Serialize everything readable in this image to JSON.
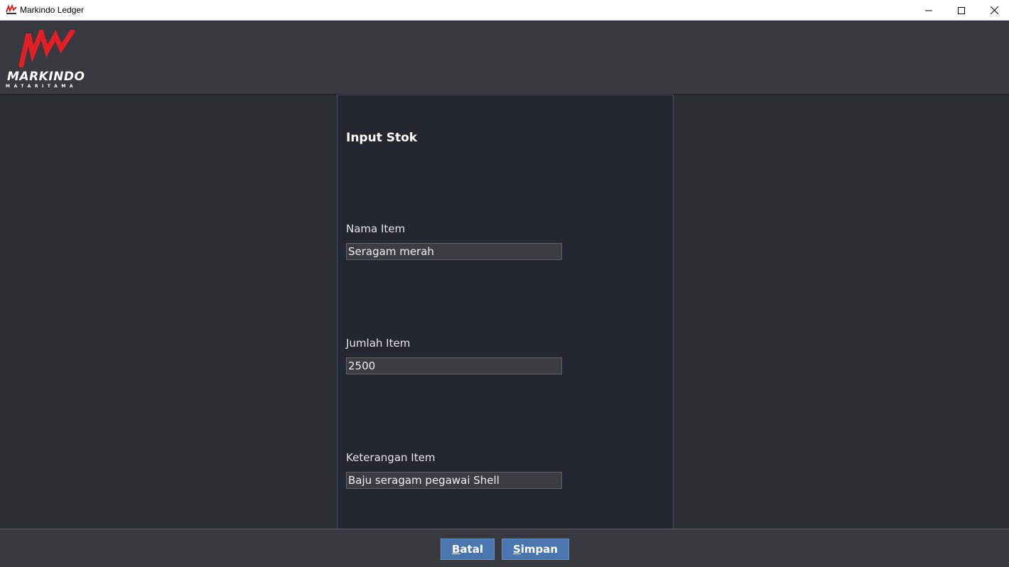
{
  "window": {
    "title": "Markindo Ledger"
  },
  "logo": {
    "brand": "MARKINDO",
    "sub": "MATARITAMA",
    "color": "#e31e24"
  },
  "form": {
    "title": "Input Stok",
    "fields": [
      {
        "label": "Nama Item",
        "value": "Seragam merah"
      },
      {
        "label": "Jumlah Item",
        "value": "2500"
      },
      {
        "label": "Keterangan Item",
        "value": "Baju seragam pegawai Shell"
      }
    ]
  },
  "buttons": {
    "cancel": {
      "mnemonic": "B",
      "rest": "atal"
    },
    "save": {
      "mnemonic": "S",
      "rest": "impan"
    }
  },
  "colors": {
    "button": "#4a76b0",
    "panel": "#232830",
    "header": "#383a40"
  }
}
